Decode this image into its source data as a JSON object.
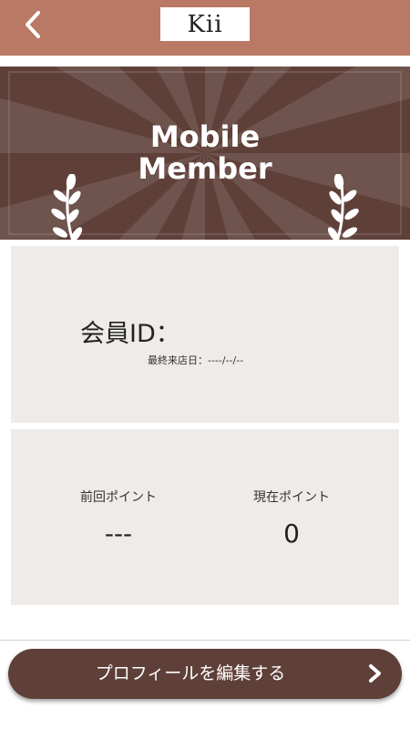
{
  "header": {
    "logo_text": "Kii",
    "back_icon": "chevron-left-icon",
    "background": "#b97964"
  },
  "banner": {
    "title_line1": "Mobile",
    "title_line2": "Member",
    "decoration": "laurel-icon",
    "background": "#5f4039"
  },
  "member_card": {
    "id_label": "会員ID：",
    "last_visit_label": "最終来店日：",
    "last_visit_value": "----/--/--"
  },
  "points_card": {
    "previous_label": "前回ポイント",
    "previous_value": "---",
    "current_label": "現在ポイント",
    "current_value": "0"
  },
  "footer": {
    "edit_profile_label": "プロフィールを編集する",
    "chevron_icon": "chevron-right-icon",
    "button_color": "#5f4039"
  }
}
